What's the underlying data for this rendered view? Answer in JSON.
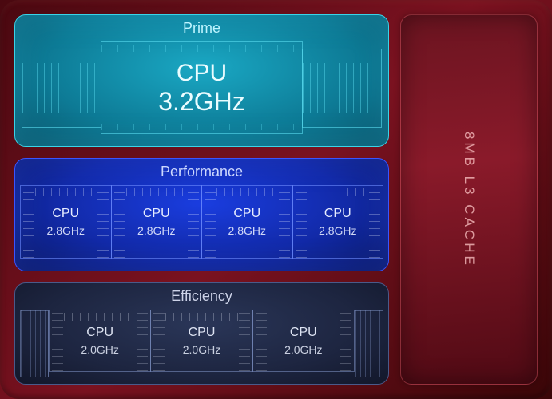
{
  "prime": {
    "title": "Prime",
    "core": {
      "name": "CPU",
      "freq": "3.2GHz"
    }
  },
  "performance": {
    "title": "Performance",
    "cores": [
      {
        "name": "CPU",
        "freq": "2.8GHz"
      },
      {
        "name": "CPU",
        "freq": "2.8GHz"
      },
      {
        "name": "CPU",
        "freq": "2.8GHz"
      },
      {
        "name": "CPU",
        "freq": "2.8GHz"
      }
    ]
  },
  "efficiency": {
    "title": "Efficiency",
    "cores": [
      {
        "name": "CPU",
        "freq": "2.0GHz"
      },
      {
        "name": "CPU",
        "freq": "2.0GHz"
      },
      {
        "name": "CPU",
        "freq": "2.0GHz"
      }
    ]
  },
  "cache": {
    "label": "8MB L3 CACHE"
  }
}
